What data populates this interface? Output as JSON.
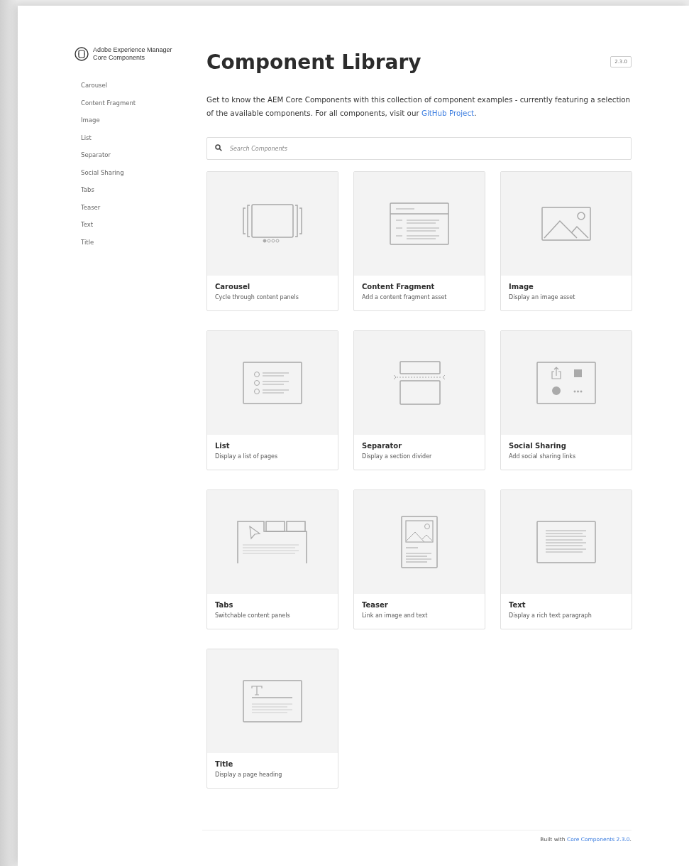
{
  "brand": {
    "title": "Adobe Experience Manager",
    "subtitle": "Core Components"
  },
  "sidebar": {
    "items": [
      {
        "label": "Carousel"
      },
      {
        "label": "Content Fragment"
      },
      {
        "label": "Image"
      },
      {
        "label": "List"
      },
      {
        "label": "Separator"
      },
      {
        "label": "Social Sharing"
      },
      {
        "label": "Tabs"
      },
      {
        "label": "Teaser"
      },
      {
        "label": "Text"
      },
      {
        "label": "Title"
      }
    ]
  },
  "header": {
    "title": "Component Library",
    "version": "2.3.0"
  },
  "intro": {
    "text": "Get to know the AEM Core Components with this collection of component examples - currently featuring a selection of the available components. For all components, visit our ",
    "link": "GitHub Project",
    "end": "."
  },
  "search": {
    "placeholder": "Search Components"
  },
  "cards": [
    {
      "kind": "carousel",
      "title": "Carousel",
      "description": "Cycle through content panels"
    },
    {
      "kind": "fragment",
      "title": "Content Fragment",
      "description": "Add a content fragment asset"
    },
    {
      "kind": "image",
      "title": "Image",
      "description": "Display an image asset"
    },
    {
      "kind": "list",
      "title": "List",
      "description": "Display a list of pages"
    },
    {
      "kind": "separator",
      "title": "Separator",
      "description": "Display a section divider"
    },
    {
      "kind": "social",
      "title": "Social Sharing",
      "description": "Add social sharing links"
    },
    {
      "kind": "tabs",
      "title": "Tabs",
      "description": "Switchable content panels"
    },
    {
      "kind": "teaser",
      "title": "Teaser",
      "description": "Link an image and text"
    },
    {
      "kind": "text",
      "title": "Text",
      "description": "Display a rich text paragraph"
    },
    {
      "kind": "title",
      "title": "Title",
      "description": "Display a page heading"
    }
  ],
  "footer": {
    "text": "Built with ",
    "link": "Core Components 2.3.0",
    "end": "."
  }
}
